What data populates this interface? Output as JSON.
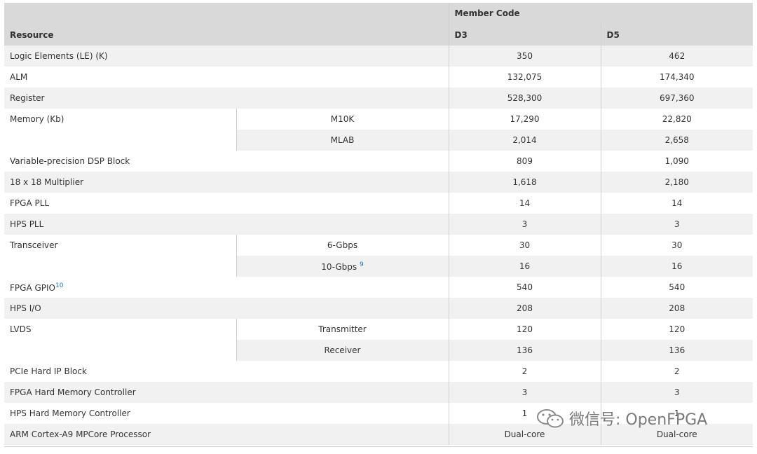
{
  "table": {
    "header": {
      "resource": "Resource",
      "member_code": "Member Code",
      "d3": "D3",
      "d5": "D5"
    },
    "rows": [
      {
        "name": "Logic Elements (LE) (K)",
        "d3": "350",
        "d5": "462"
      },
      {
        "name": "ALM",
        "d3": "132,075",
        "d5": "174,340"
      },
      {
        "name": "Register",
        "d3": "528,300",
        "d5": "697,360"
      },
      {
        "name": "Memory (Kb)",
        "sub": "M10K",
        "d3": "17,290",
        "d5": "22,820"
      },
      {
        "sub": "MLAB",
        "d3": "2,014",
        "d5": "2,658"
      },
      {
        "name": "Variable-precision DSP Block",
        "d3": "809",
        "d5": "1,090"
      },
      {
        "name": "18 x 18 Multiplier",
        "d3": "1,618",
        "d5": "2,180"
      },
      {
        "name": "FPGA PLL",
        "d3": "14",
        "d5": "14"
      },
      {
        "name": "HPS PLL",
        "d3": "3",
        "d5": "3"
      },
      {
        "name": "Transceiver",
        "sub": "6-Gbps",
        "d3": "30",
        "d5": "30"
      },
      {
        "sub": "10-Gbps",
        "sub_note": "9",
        "d3": "16",
        "d5": "16"
      },
      {
        "name": "FPGA GPIO",
        "name_note": "10",
        "d3": "540",
        "d5": "540"
      },
      {
        "name": "HPS I/O",
        "d3": "208",
        "d5": "208"
      },
      {
        "name": "LVDS",
        "sub": "Transmitter",
        "d3": "120",
        "d5": "120"
      },
      {
        "sub": "Receiver",
        "d3": "136",
        "d5": "136"
      },
      {
        "name": "PCIe Hard IP Block",
        "d3": "2",
        "d5": "2"
      },
      {
        "name": "FPGA Hard Memory Controller",
        "d3": "3",
        "d5": "3"
      },
      {
        "name": "HPS Hard Memory Controller",
        "d3": "1",
        "d5": "1"
      },
      {
        "name": "ARM Cortex-A9 MPCore Processor",
        "d3": "Dual-core",
        "d5": "Dual-core"
      }
    ]
  },
  "watermark": {
    "text": "微信号: OpenFPGA",
    "icon": "wechat-icon"
  }
}
